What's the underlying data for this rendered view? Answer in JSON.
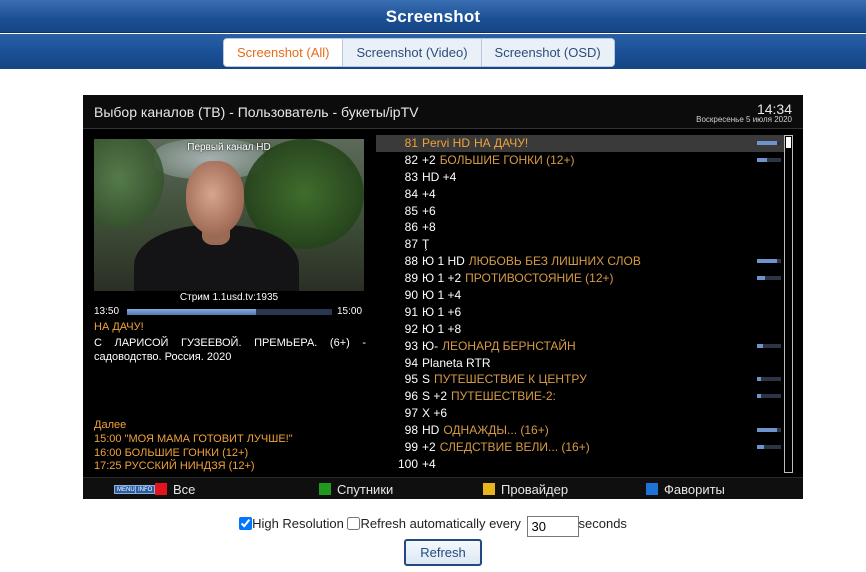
{
  "header": {
    "title": "Screenshot"
  },
  "tabs": [
    {
      "label": "Screenshot (All)",
      "active": true
    },
    {
      "label": "Screenshot (Video)",
      "active": false
    },
    {
      "label": "Screenshot (OSD)",
      "active": false
    }
  ],
  "screen": {
    "title": "Выбор каналов (ТВ) - Пользователь - букеты/ipTV",
    "time": "14:34",
    "date": "Воскресенье  5 июля 2020",
    "pip_label": "Первый канал HD",
    "stream": "Стрим 1.1usd.tv:1935",
    "progress": {
      "start": "13:50",
      "end": "15:00",
      "fraction": 0.63
    },
    "event_title": "НА ДАЧУ!",
    "event_desc": "С ЛАРИСОЙ ГУЗЕЕВОЙ. ПРЕМЬЕРА. (6+) - садоводство. Россия. 2020",
    "next_label": "Далее",
    "next_items": [
      "15:00 \"МОЯ МАМА ГОТОВИТ ЛУЧШЕ!\"",
      "16:00 БОЛЬШИЕ ГОНКИ (12+)",
      "17:25 РУССКИЙ НИНДЗЯ (12+)"
    ],
    "channels": [
      {
        "num": "81",
        "name": "Pervi HD",
        "event": "НА ДАЧУ!",
        "progress": 0.85,
        "selected": true
      },
      {
        "num": "82",
        "name": "+2",
        "event": "БОЛЬШИЕ ГОНКИ (12+)",
        "progress": 0.4
      },
      {
        "num": "83",
        "name": "HD +4",
        "event": ""
      },
      {
        "num": "84",
        "name": "+4",
        "event": ""
      },
      {
        "num": "85",
        "name": "+6",
        "event": ""
      },
      {
        "num": "86",
        "name": "+8",
        "event": ""
      },
      {
        "num": "87",
        "name": "Ţ",
        "event": ""
      },
      {
        "num": "88",
        "name": "Ю 1 HD",
        "event": "ЛЮБОВЬ БЕЗ ЛИШНИХ СЛОВ",
        "progress": 0.85
      },
      {
        "num": "89",
        "name": "Ю 1 +2",
        "event": "ПРОТИВОСТОЯНИЕ (12+)",
        "progress": 0.35
      },
      {
        "num": "90",
        "name": "Ю 1 +4",
        "event": ""
      },
      {
        "num": "91",
        "name": "Ю 1 +6",
        "event": ""
      },
      {
        "num": "92",
        "name": "Ю 1 +8",
        "event": ""
      },
      {
        "num": "93",
        "name": "Ю-",
        "event": "ЛЕОНАРД БЕРНСТАЙН",
        "progress": 0.25
      },
      {
        "num": "94",
        "name": "Planeta RTR",
        "event": ""
      },
      {
        "num": "95",
        "name": "S",
        "event": "ПУТЕШЕСТВИЕ К ЦЕНТРУ",
        "progress": 0.15
      },
      {
        "num": "96",
        "name": "S +2",
        "event": "ПУТЕШЕСТВИЕ-2:",
        "progress": 0.15
      },
      {
        "num": "97",
        "name": "X +6",
        "event": ""
      },
      {
        "num": "98",
        "name": "HD",
        "event": "ОДНАЖДЫ... (16+)",
        "progress": 0.85
      },
      {
        "num": "99",
        "name": "+2",
        "event": "СЛЕДСТВИЕ ВЕЛИ... (16+)",
        "progress": 0.3
      },
      {
        "num": "100",
        "name": "+4",
        "event": ""
      }
    ],
    "footer": {
      "menu_btn": "MENU",
      "info_btn": "INFO",
      "keys": [
        {
          "label": "Все",
          "color": "#e3141c"
        },
        {
          "label": "Спутники",
          "color": "#1f9a1f"
        },
        {
          "label": "Провайдер",
          "color": "#e6b41c"
        },
        {
          "label": "Фавориты",
          "color": "#1e73d6"
        }
      ]
    }
  },
  "form": {
    "high_res_label": "High Resolution",
    "high_res_checked": true,
    "refresh_auto_label": "Refresh automatically every",
    "refresh_auto_checked": false,
    "interval_value": "30",
    "seconds_label": "seconds",
    "refresh_button": "Refresh"
  }
}
